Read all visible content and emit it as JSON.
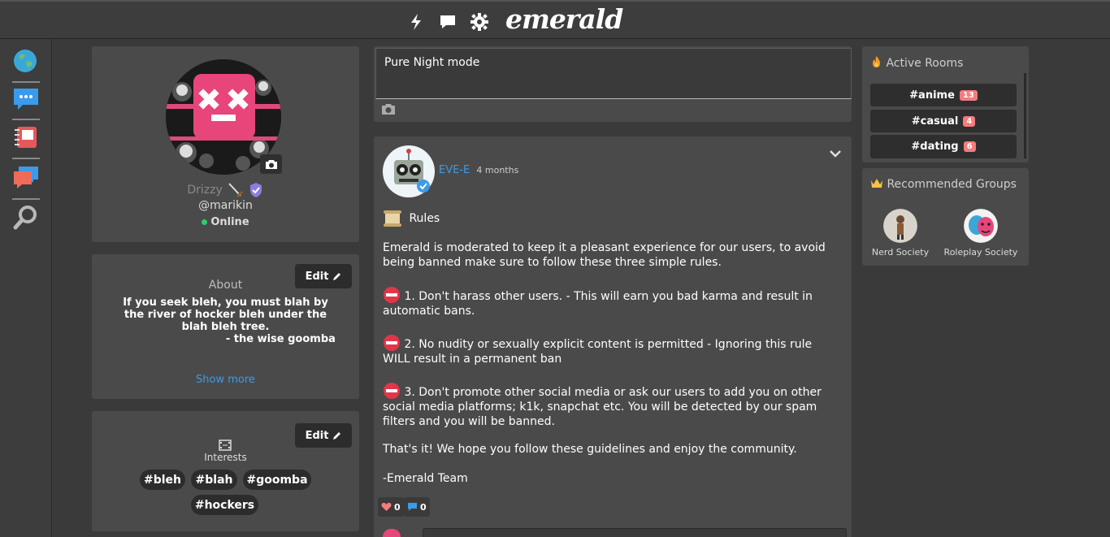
{
  "brand": "emerald",
  "profile": {
    "display_name": "Drizzy",
    "handle": "@marikin",
    "status": "Online"
  },
  "about": {
    "title": "About",
    "edit_label": "Edit",
    "text": "If you seek bleh, you must blah by the river of hocker bleh under the blah bleh tree.\n                              - the wise goomba",
    "show_more": "Show more"
  },
  "interests": {
    "title": "Interests",
    "edit_label": "Edit",
    "tags": [
      "#bleh",
      "#blah",
      "#goomba",
      "#hockers"
    ]
  },
  "composer": {
    "text": "Pure Night mode"
  },
  "post": {
    "author": "EVE-E",
    "time": "4 months",
    "title": "Rules",
    "intro": "Emerald is moderated to keep it a pleasant experience for our users, to avoid being banned make sure to follow these three simple rules.",
    "rules": [
      "1. Don't harass other users. - This will earn you bad karma and result in automatic bans.",
      "2. No nudity or sexually explicit content is permitted - Ignoring this rule WILL result in a permanent ban",
      "3. Don't promote other social media or ask our users to add you on other social media platforms; k1k, snapchat etc. You will be detected by our spam filters and you will be banned."
    ],
    "outro": "That's it! We hope you follow these guidelines and enjoy the community.",
    "signature": "-Emerald Team",
    "likes": "0",
    "comments": "0"
  },
  "active_rooms": {
    "title": "Active Rooms",
    "rooms": [
      {
        "name": "#anime",
        "count": "13"
      },
      {
        "name": "#casual",
        "count": "4"
      },
      {
        "name": "#dating",
        "count": "6"
      }
    ]
  },
  "recommended_groups": {
    "title": "Recommended Groups",
    "groups": [
      {
        "name": "Nerd Society"
      },
      {
        "name": "Roleplay Society"
      }
    ]
  },
  "colors": {
    "accent_blue": "#3b9bea",
    "online_green": "#2ecc71",
    "badge_red": "#f47c7c",
    "card_bg": "#4b4a4a",
    "page_bg": "#3a3a3a"
  }
}
